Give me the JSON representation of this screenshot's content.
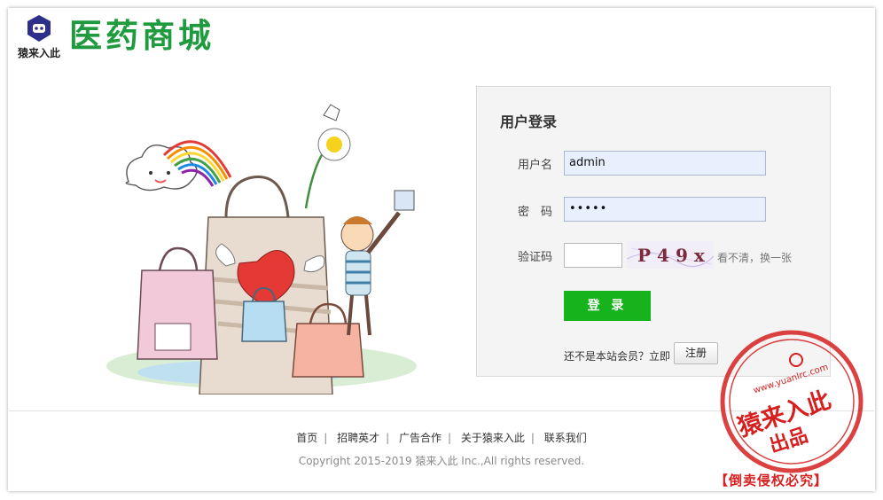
{
  "header": {
    "logo_text": "猿来入此",
    "brand_title": "医药商城"
  },
  "login": {
    "title": "用户登录",
    "username_label": "用户名",
    "username_value": "admin",
    "password_label": "密　码",
    "password_value": "•••••",
    "captcha_label": "验证码",
    "captcha_value": "",
    "captcha_image_text": "P49x",
    "refresh_link": "看不清，换一张",
    "login_button": "登 录",
    "member_prompt": "还不是本站会员？立即",
    "register_button": "注册"
  },
  "footer": {
    "nav": [
      "首页",
      "招聘英才",
      "广告合作",
      "关于猿来入此",
      "联系我们"
    ],
    "copyright": "Copyright 2015-2019 猿来入此 Inc.,All rights reserved."
  },
  "watermark": {
    "stamp_url": "www.yuanlrc.com",
    "stamp_main": "猿来入此",
    "stamp_sub": "出品",
    "caption": "【倒卖侵权必究】"
  },
  "colors": {
    "brand_green": "#1f9a3e",
    "login_button": "#16b31d",
    "input_fill": "#e8f0fe",
    "stamp_red": "#d62020"
  },
  "icons": {
    "logo": "robot-head-badge-icon"
  }
}
